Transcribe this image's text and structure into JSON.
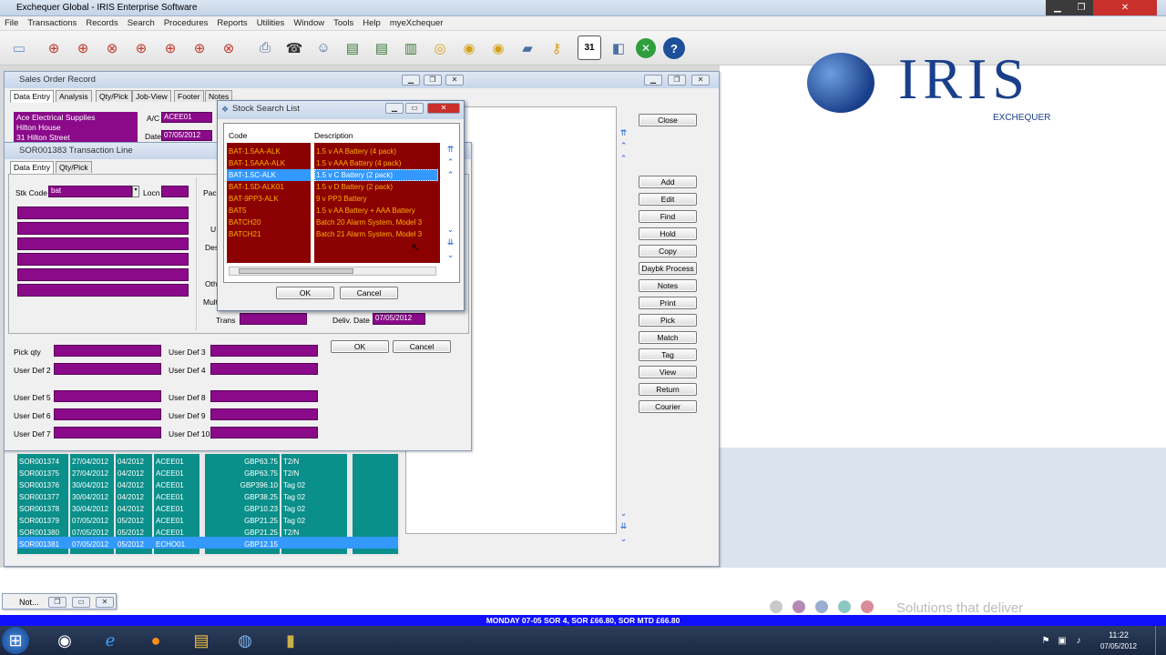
{
  "app": {
    "title": "Exchequer Global - IRIS Enterprise Software"
  },
  "menu": [
    "File",
    "Transactions",
    "Records",
    "Search",
    "Procedures",
    "Reports",
    "Utilities",
    "Window",
    "Tools",
    "Help",
    "myeXchequer"
  ],
  "toolbar_icons": [
    "new-doc-icon",
    "search-doc-icon",
    "find-doc-icon",
    "find-cancel-icon",
    "search-stock-icon",
    "doc-search-icon",
    "doc-find-icon",
    "doc-cancel-icon",
    "print-icon",
    "phone-icon",
    "person-icon",
    "tickets-icon",
    "list-icon",
    "list-alt-icon",
    "sheets-icon",
    "coins-icon",
    "coins-alt-icon",
    "coins-user-icon",
    "folder-icon",
    "key-icon",
    "calendar-icon",
    "window-icon",
    "exit-icon",
    "help-icon"
  ],
  "calendar_label": "31",
  "brand": {
    "logo_text": "IRIS",
    "subtitle": "EXCHEQUER",
    "tagline": "Solutions that deliver"
  },
  "sales_order": {
    "title": "Sales Order Record",
    "tabs": [
      "Data Entry",
      "Analysis",
      "Qty/Pick",
      "Job-View",
      "Footer",
      "Notes"
    ],
    "address": [
      "Ace Electrical Supplies",
      "Hilton House",
      "31 Hilton Street"
    ],
    "ac_label": "A/C",
    "ac_value": "ACEE01",
    "date_label": "Date",
    "date_value": "07/05/2012"
  },
  "right_buttons": [
    "Close",
    "Add",
    "Edit",
    "Find",
    "Hold",
    "Copy",
    "Daybk Process",
    "Notes",
    "Print",
    "Pick",
    "Match",
    "Tag",
    "View",
    "Return",
    "Courier"
  ],
  "grid": {
    "rows": [
      [
        "SOR001374",
        "27/04/2012",
        "04/2012",
        "ACEE01",
        "GBP63.75",
        "T2/N"
      ],
      [
        "SOR001375",
        "27/04/2012",
        "04/2012",
        "ACEE01",
        "GBP63.75",
        "T2/N"
      ],
      [
        "SOR001376",
        "30/04/2012",
        "04/2012",
        "ACEE01",
        "GBP396.10",
        "Tag 02"
      ],
      [
        "SOR001377",
        "30/04/2012",
        "04/2012",
        "ACEE01",
        "GBP38.25",
        "Tag 02"
      ],
      [
        "SOR001378",
        "30/04/2012",
        "04/2012",
        "ACEE01",
        "GBP10.23",
        "Tag 02"
      ],
      [
        "SOR001379",
        "07/05/2012",
        "05/2012",
        "ACEE01",
        "GBP21.25",
        "Tag 02"
      ],
      [
        "SOR001380",
        "07/05/2012",
        "05/2012",
        "ACEE01",
        "GBP21.25",
        "T2/N"
      ],
      [
        "SOR001381",
        "07/05/2012",
        "05/2012",
        "ECHO01",
        "GBP12.15",
        ""
      ]
    ]
  },
  "trans_line": {
    "title": "SOR001383 Transaction Line",
    "tabs": [
      "Data Entry",
      "Qty/Pick"
    ],
    "stk_code_label": "Stk Code",
    "stk_code_value": "bat",
    "locn_label": "Locn",
    "labels": {
      "pack": "Pack",
      "u": "U",
      "desc": "Desc",
      "oth": "Oth",
      "mult": "Mult",
      "trans": "Trans",
      "deliv": "Deliv. Date",
      "deliv_value": "07/05/2012"
    },
    "pick_qty": "Pick qty",
    "user_defs": [
      "User Def 2",
      "User Def 3",
      "User Def 4",
      "User Def 5",
      "User Def 6",
      "User Def 7",
      "User Def 8",
      "User Def 9",
      "User Def 10"
    ],
    "ok": "OK",
    "cancel": "Cancel"
  },
  "stock_search": {
    "title": "Stock Search List",
    "col_code": "Code",
    "col_desc": "Description",
    "rows": [
      [
        "BAT-1.5AA-ALK",
        "1.5 v AA Battery (4 pack)"
      ],
      [
        "BAT-1.5AAA-ALK",
        "1.5 v AAA Battery (4 pack)"
      ],
      [
        "BAT-1.5C-ALK",
        "1.5 v C Battery (2 pack)"
      ],
      [
        "BAT-1.5D-ALK01",
        "1.5 v D Battery (2 pack)"
      ],
      [
        "BAT-9PP3-ALK",
        "9 v PP3 Battery"
      ],
      [
        "BAT5",
        "1.5 v AA Battery + AAA Battery"
      ],
      [
        "BATCH20",
        "Batch 20 Alarm System, Model 3"
      ],
      [
        "BATCH21",
        "Batch 21 Alarm System, Model 3"
      ]
    ],
    "selected": 2,
    "ok": "OK",
    "cancel": "Cancel"
  },
  "status_bar": "MONDAY 07-05  SOR 4,  SOR £66.80,  SOR MTD £66.80",
  "mini_window": "Not...",
  "tray": {
    "time": "11:22",
    "date": "07/05/2012"
  }
}
